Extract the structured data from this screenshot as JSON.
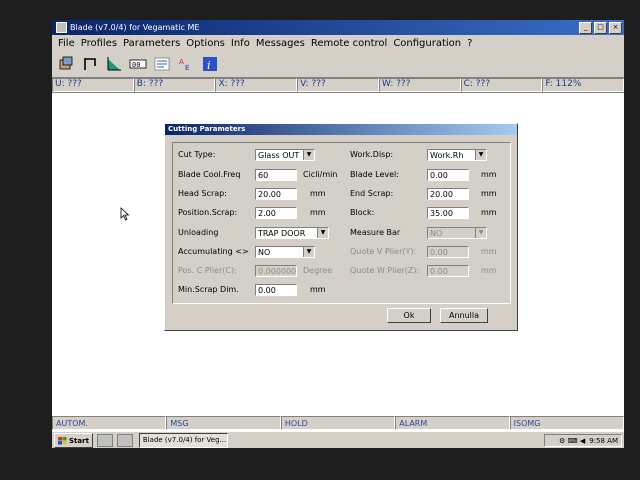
{
  "window": {
    "title": "Blade (v7.0/4) for Vegamatic ME"
  },
  "menu": [
    "File",
    "Profiles",
    "Parameters",
    "Options",
    "Info",
    "Messages",
    "Remote control",
    "Configuration",
    "?"
  ],
  "toolbar_icons": [
    "profile-icon",
    "frame-icon",
    "chart-icon",
    "counter-icon",
    "list-icon",
    "text-icon",
    "info-icon"
  ],
  "axes": [
    {
      "label": "U: ???"
    },
    {
      "label": "B: ???"
    },
    {
      "label": "X: ???"
    },
    {
      "label": "V: ???"
    },
    {
      "label": "W: ???"
    },
    {
      "label": "C: ???"
    },
    {
      "label": "F: 112%"
    }
  ],
  "dialog": {
    "title": "Cutting Parameters",
    "left": {
      "cut_type": {
        "label": "Cut Type:",
        "value": "Glass OUT"
      },
      "blade_cool": {
        "label": "Blade Cool.Freq",
        "value": "60",
        "unit": "Cicli/min"
      },
      "head_scrap": {
        "label": "Head Scrap:",
        "value": "20.00",
        "unit": "mm"
      },
      "position_scrap": {
        "label": "Position.Scrap:",
        "value": "2.00",
        "unit": "mm"
      },
      "unloading": {
        "label": "Unloading",
        "value": "TRAP DOOR"
      },
      "accumulating": {
        "label": "Accumulating <>",
        "value": "NO"
      },
      "pos_c_plier": {
        "label": "Pos. C Plier(C):",
        "value": "0.000000",
        "unit": "Degree"
      },
      "min_scrap": {
        "label": "Min.Scrap Dim.",
        "value": "0.00",
        "unit": "mm"
      }
    },
    "right": {
      "work_disp": {
        "label": "Work.Disp:",
        "value": "Work.Rh"
      },
      "blade_level": {
        "label": "Blade Level:",
        "value": "0.00",
        "unit": "mm"
      },
      "end_scrap": {
        "label": "End Scrap:",
        "value": "20.00",
        "unit": "mm"
      },
      "block": {
        "label": "Block:",
        "value": "35.00",
        "unit": "mm"
      },
      "measure_bar": {
        "label": "Measure Bar",
        "value": "NO"
      },
      "quote_v": {
        "label": "Quote V Plier(Y):",
        "value": "0.00",
        "unit": "mm"
      },
      "quote_w": {
        "label": "Quote W Plier(Z):",
        "value": "0.00",
        "unit": "mm"
      }
    },
    "ok_label": "Ok",
    "cancel_label": "Annulla"
  },
  "status": [
    "AUTOM.",
    "MSG",
    "HOLD",
    "ALARM",
    "ISOMG"
  ],
  "taskbar": {
    "start_label": "Start",
    "task_label": "Blade (v7.0/4) for Veg...",
    "clock": "9:58 AM"
  }
}
